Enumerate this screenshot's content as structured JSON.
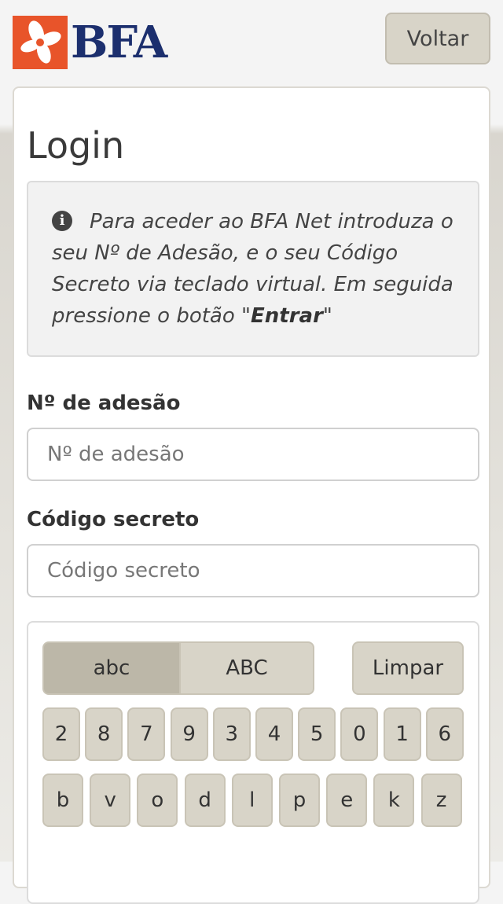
{
  "header": {
    "logo_text": "BFA",
    "back_label": "Voltar"
  },
  "page": {
    "title": "Login",
    "info": {
      "text_prefix": "Para aceder ao BFA Net introduza o seu Nº de Adesão, e o seu Código Secreto via teclado virtual. Em seguida pressione o botão \"",
      "text_bold": "Entrar",
      "text_suffix": "\""
    },
    "adhesion": {
      "label": "Nº de adesão",
      "placeholder": "Nº de adesão",
      "value": ""
    },
    "secret": {
      "label": "Código secreto",
      "placeholder": "Código secreto",
      "value": ""
    }
  },
  "keyboard": {
    "lowercase_label": "abc",
    "uppercase_label": "ABC",
    "active_mode": "abc",
    "clear_label": "Limpar",
    "number_row": [
      "2",
      "8",
      "7",
      "9",
      "3",
      "4",
      "5",
      "0",
      "1",
      "6"
    ],
    "letter_row_1": [
      "b",
      "v",
      "o",
      "d",
      "l",
      "p",
      "e",
      "k",
      "z"
    ]
  },
  "colors": {
    "brand_orange": "#e8542a",
    "brand_navy": "#1c2f6e",
    "button_bg": "#d8d4c8",
    "button_active_bg": "#bcb7a8"
  }
}
